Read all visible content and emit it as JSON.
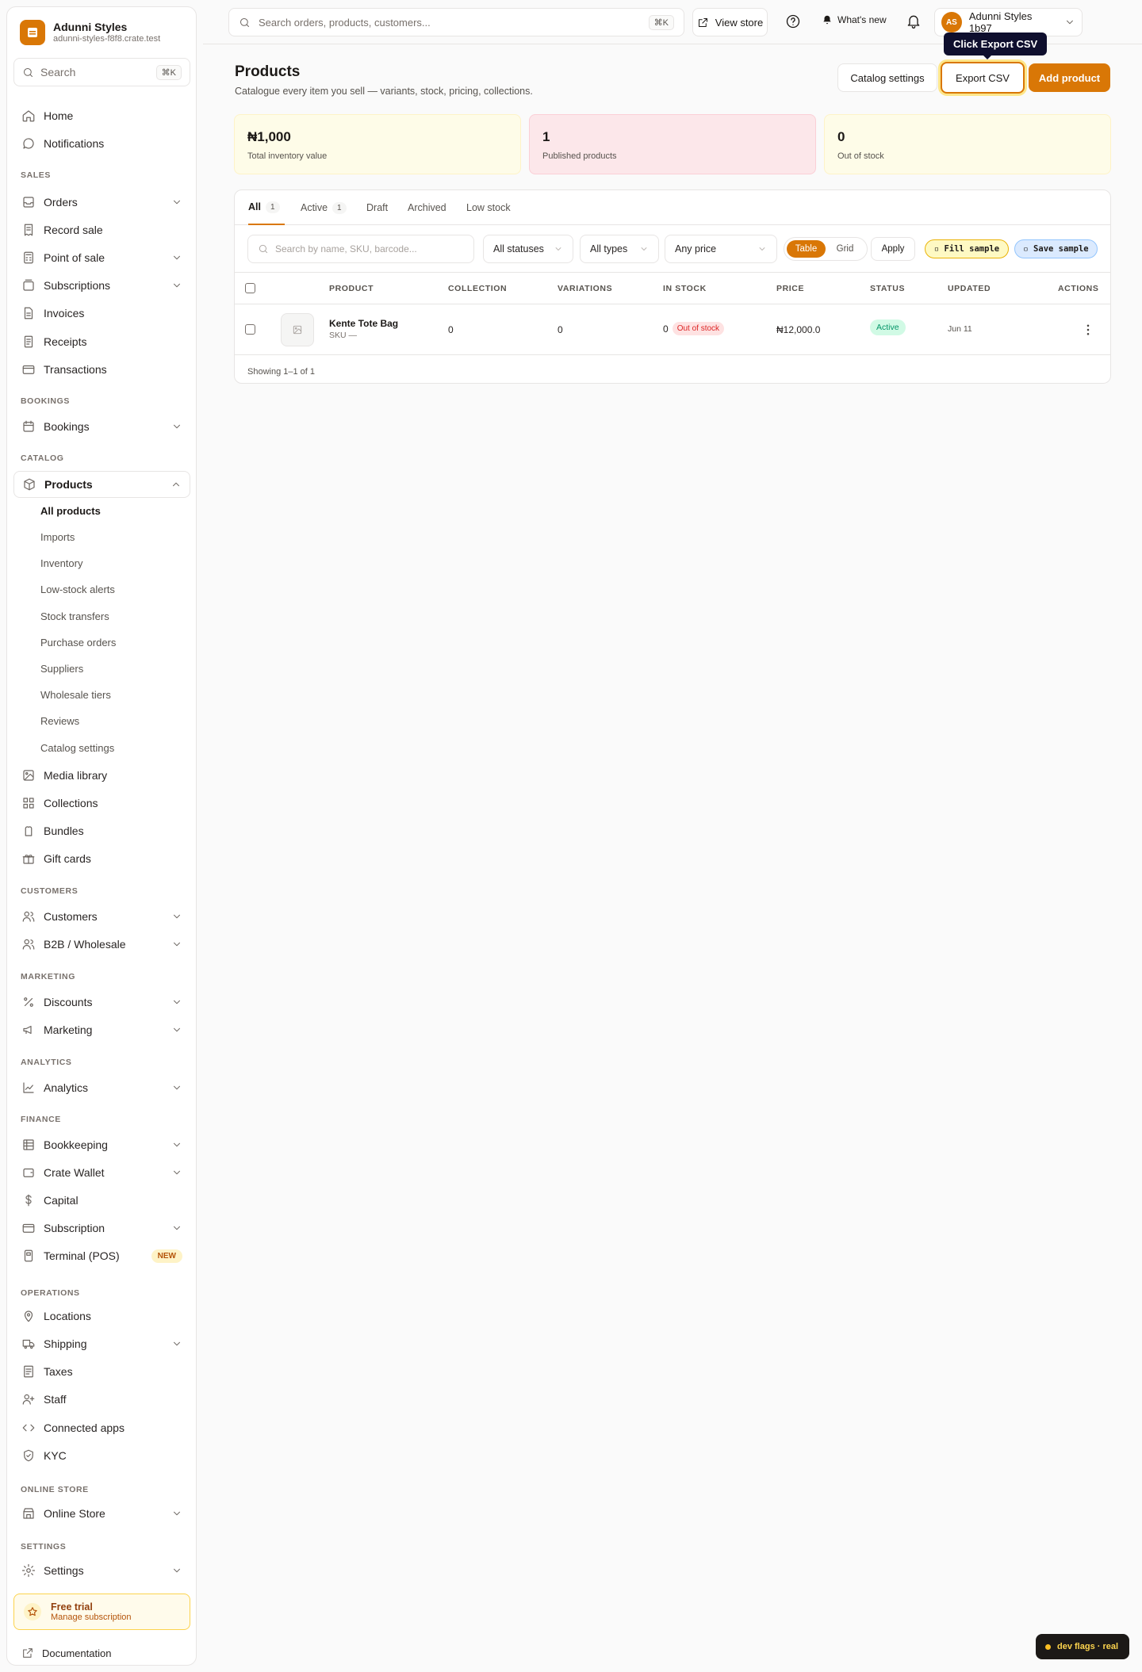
{
  "brand": {
    "name": "Adunni Styles",
    "domain": "adunni-styles-f8f8.crate.test"
  },
  "sidebar": {
    "search_placeholder": "Search",
    "search_kbd": "⌘K",
    "top_items": [
      {
        "label": "Home"
      },
      {
        "label": "Notifications"
      }
    ],
    "sections": {
      "sales": "SALES",
      "bookings": "BOOKINGS",
      "catalog": "CATALOG",
      "customers": "CUSTOMERS",
      "marketing": "MARKETING",
      "analytics": "ANALYTICS",
      "finance": "FINANCE",
      "operations": "OPERATIONS",
      "online_store": "ONLINE STORE",
      "settings": "SETTINGS"
    },
    "sales_items": [
      {
        "label": "Orders"
      },
      {
        "label": "Record sale"
      },
      {
        "label": "Point of sale"
      },
      {
        "label": "Subscriptions"
      },
      {
        "label": "Invoices"
      },
      {
        "label": "Receipts"
      },
      {
        "label": "Transactions"
      }
    ],
    "bookings_items": [
      {
        "label": "Bookings"
      }
    ],
    "catalog_items": [
      {
        "label": "Products"
      }
    ],
    "products_sub": [
      {
        "label": "All products"
      },
      {
        "label": "Imports"
      },
      {
        "label": "Inventory"
      },
      {
        "label": "Low-stock alerts"
      },
      {
        "label": "Stock transfers"
      },
      {
        "label": "Purchase orders"
      },
      {
        "label": "Suppliers"
      },
      {
        "label": "Wholesale tiers"
      },
      {
        "label": "Reviews"
      },
      {
        "label": "Catalog settings"
      }
    ],
    "catalog_more": [
      {
        "label": "Media library"
      },
      {
        "label": "Collections"
      },
      {
        "label": "Bundles"
      },
      {
        "label": "Gift cards"
      }
    ],
    "customers_items": [
      {
        "label": "Customers"
      },
      {
        "label": "B2B / Wholesale"
      }
    ],
    "marketing_items": [
      {
        "label": "Discounts"
      },
      {
        "label": "Marketing"
      }
    ],
    "analytics_items": [
      {
        "label": "Analytics"
      }
    ],
    "finance_items": [
      {
        "label": "Bookkeeping"
      },
      {
        "label": "Crate Wallet"
      },
      {
        "label": "Capital"
      },
      {
        "label": "Subscription"
      },
      {
        "label": "Terminal (POS)"
      }
    ],
    "new_badge": "NEW",
    "operations_items": [
      {
        "label": "Locations"
      },
      {
        "label": "Shipping"
      },
      {
        "label": "Taxes"
      },
      {
        "label": "Staff"
      },
      {
        "label": "Connected apps"
      },
      {
        "label": "KYC"
      }
    ],
    "online_store_items": [
      {
        "label": "Online Store"
      }
    ],
    "settings_items": [
      {
        "label": "Settings"
      }
    ],
    "trial": {
      "title": "Free trial",
      "subtitle": "Manage subscription"
    },
    "documentation": "Documentation"
  },
  "topbar": {
    "search_placeholder": "Search orders, products, customers...",
    "search_kbd": "⌘K",
    "view_store": "View store",
    "whats_new": "What's new",
    "account_initials": "AS",
    "account_name": "Adunni Styles 1b97"
  },
  "tooltip": "Click Export CSV",
  "page": {
    "title": "Products",
    "subtitle": "Catalogue every item you sell — variants, stock, pricing, collections.",
    "catalog_settings": "Catalog settings",
    "export_csv": "Export CSV",
    "add_product": "Add product"
  },
  "stats": [
    {
      "value": "₦1,000",
      "label": "Total inventory value",
      "bg": "#fefce8",
      "border": "#fef3c7"
    },
    {
      "value": "1",
      "label": "Published products",
      "bg": "#fce7ea",
      "border": "#fbcfd6"
    },
    {
      "value": "0",
      "label": "Out of stock",
      "bg": "#fefce8",
      "border": "#fef3c7"
    }
  ],
  "tabs": [
    {
      "label": "All",
      "count": "1"
    },
    {
      "label": "Active",
      "count": "1"
    },
    {
      "label": "Draft"
    },
    {
      "label": "Archived"
    },
    {
      "label": "Low stock"
    }
  ],
  "filters": {
    "search_placeholder": "Search by name, SKU, barcode...",
    "status": "All statuses",
    "type": "All types",
    "price": "Any price",
    "view_table": "Table",
    "view_grid": "Grid",
    "apply": "Apply",
    "fill_sample": "▫ Fill sample",
    "save_sample": "▫ Save sample"
  },
  "table": {
    "columns": [
      "PRODUCT",
      "COLLECTION",
      "VARIATIONS",
      "IN STOCK",
      "PRICE",
      "STATUS",
      "UPDATED",
      "ACTIONS"
    ],
    "rows": [
      {
        "name": "Kente Tote Bag",
        "sku": "SKU —",
        "collection": "0",
        "variations": "0",
        "in_stock": "0",
        "stock_badge": "Out of stock",
        "price": "₦12,000.0",
        "status": "Active",
        "updated": "Jun 11"
      }
    ],
    "footer": "Showing 1–1 of 1"
  },
  "devflags": "dev flags · real",
  "colors": {
    "accent": "#d97706",
    "tooltip_bg": "#0f0f2e"
  }
}
